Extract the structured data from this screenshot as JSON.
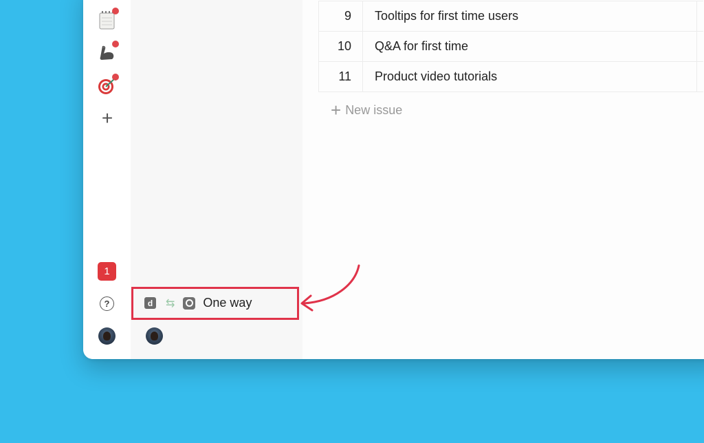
{
  "rail": {
    "items": [
      {
        "icon": "notepad-icon",
        "has_notification": true
      },
      {
        "icon": "flexed-biceps-icon",
        "has_notification": true
      },
      {
        "icon": "target-icon",
        "has_notification": true
      }
    ],
    "add_symbol": "+",
    "notification_count": "1",
    "help_symbol": "?"
  },
  "sync": {
    "source_letter": "d",
    "direction_symbol": "⇆",
    "label": "One way"
  },
  "issues": [
    {
      "number": "9",
      "title": "Tooltips for first time users"
    },
    {
      "number": "10",
      "title": "Q&A for first time"
    },
    {
      "number": "11",
      "title": "Product video tutorials"
    }
  ],
  "new_issue": {
    "plus": "+",
    "label": "New issue"
  },
  "colors": {
    "background": "#36bcec",
    "highlight": "#e0334a",
    "notification_dot": "#e0474c",
    "badge": "#e0383d"
  }
}
